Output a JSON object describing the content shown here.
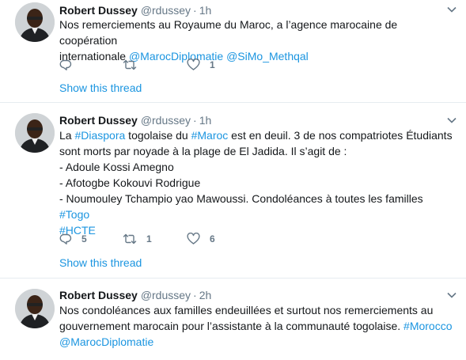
{
  "tweets": [
    {
      "name": "Robert Dussey",
      "handle": "@rdussey",
      "dot": "·",
      "time": "1h",
      "lines": [
        [
          {
            "t": "Nos remerciements au Royaume du Maroc, a l’agence marocaine de coopération"
          }
        ],
        [
          {
            "t": "internationale "
          },
          {
            "t": "@MarocDiplomatie",
            "link": true
          },
          {
            "t": " "
          },
          {
            "t": "@SiMo_Methqal",
            "link": true
          }
        ]
      ],
      "replies": "",
      "retweets": "",
      "likes": "1",
      "show_thread": "Show this thread"
    },
    {
      "name": "Robert Dussey",
      "handle": "@rdussey",
      "dot": "·",
      "time": "1h",
      "lines": [
        [
          {
            "t": "La "
          },
          {
            "t": "#Diaspora",
            "link": true
          },
          {
            "t": " togolaise du "
          },
          {
            "t": "#Maroc",
            "link": true
          },
          {
            "t": " est en deuil. 3 de nos compatriotes Étudiants"
          }
        ],
        [
          {
            "t": "sont morts par noyade à la plage de El Jadida. Il s’agit de :"
          }
        ],
        [
          {
            "t": "- Adoule Kossi Amegno"
          }
        ],
        [
          {
            "t": "- Afotogbe Kokouvi Rodrigue"
          }
        ],
        [
          {
            "t": "- Noumouley Tchampio yao Mawoussi. Condoléances à toutes les familles "
          },
          {
            "t": "#Togo",
            "link": true
          }
        ],
        [
          {
            "t": "#HCTE",
            "link": true
          }
        ]
      ],
      "replies": "5",
      "retweets": "1",
      "likes": "6",
      "show_thread": "Show this thread"
    },
    {
      "name": "Robert Dussey",
      "handle": "@rdussey",
      "dot": "·",
      "time": "2h",
      "lines": [
        [
          {
            "t": "Nos condoléances aux familles endeuillées et surtout nos remerciements au"
          }
        ],
        [
          {
            "t": "gouvernement marocain pour l’assistante à la communauté togolaise. "
          },
          {
            "t": "#Morocco",
            "link": true
          }
        ],
        [
          {
            "t": "@MarocDiplomatie",
            "link": true
          }
        ]
      ],
      "replies": "",
      "retweets": "",
      "likes": "",
      "show_thread": ""
    }
  ],
  "icons": {
    "reply": "reply-icon",
    "retweet": "retweet-icon",
    "like": "heart-icon",
    "caret": "chevron-down-icon",
    "avatar": "avatar"
  },
  "colors": {
    "link": "#1b95e0",
    "secondary": "#657786",
    "divider": "#e6ecf0"
  }
}
